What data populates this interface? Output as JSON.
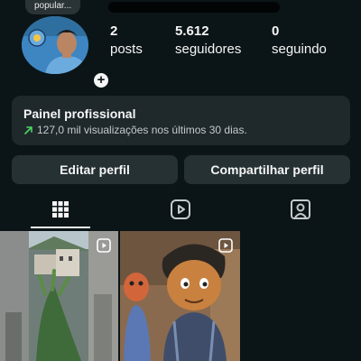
{
  "profile": {
    "note": "popular...",
    "stats": [
      {
        "num": "2",
        "label": "posts"
      },
      {
        "num": "5.612",
        "label": "seguidores"
      },
      {
        "num": "0",
        "label": "seguindo"
      }
    ]
  },
  "panel": {
    "title": "Painel profissional",
    "subtitle": "127,0 mil visualizações nos últimos 30 dias."
  },
  "actions": {
    "edit": "Editar perfil",
    "share": "Compartilhar perfil"
  },
  "tabs": [
    {
      "icon": "grid-icon",
      "active": true
    },
    {
      "icon": "reels-icon",
      "active": false
    },
    {
      "icon": "tagged-icon",
      "active": false
    }
  ],
  "colors": {
    "background": "#0b1517",
    "card": "#1f292c",
    "accent_green": "#4cd964"
  }
}
